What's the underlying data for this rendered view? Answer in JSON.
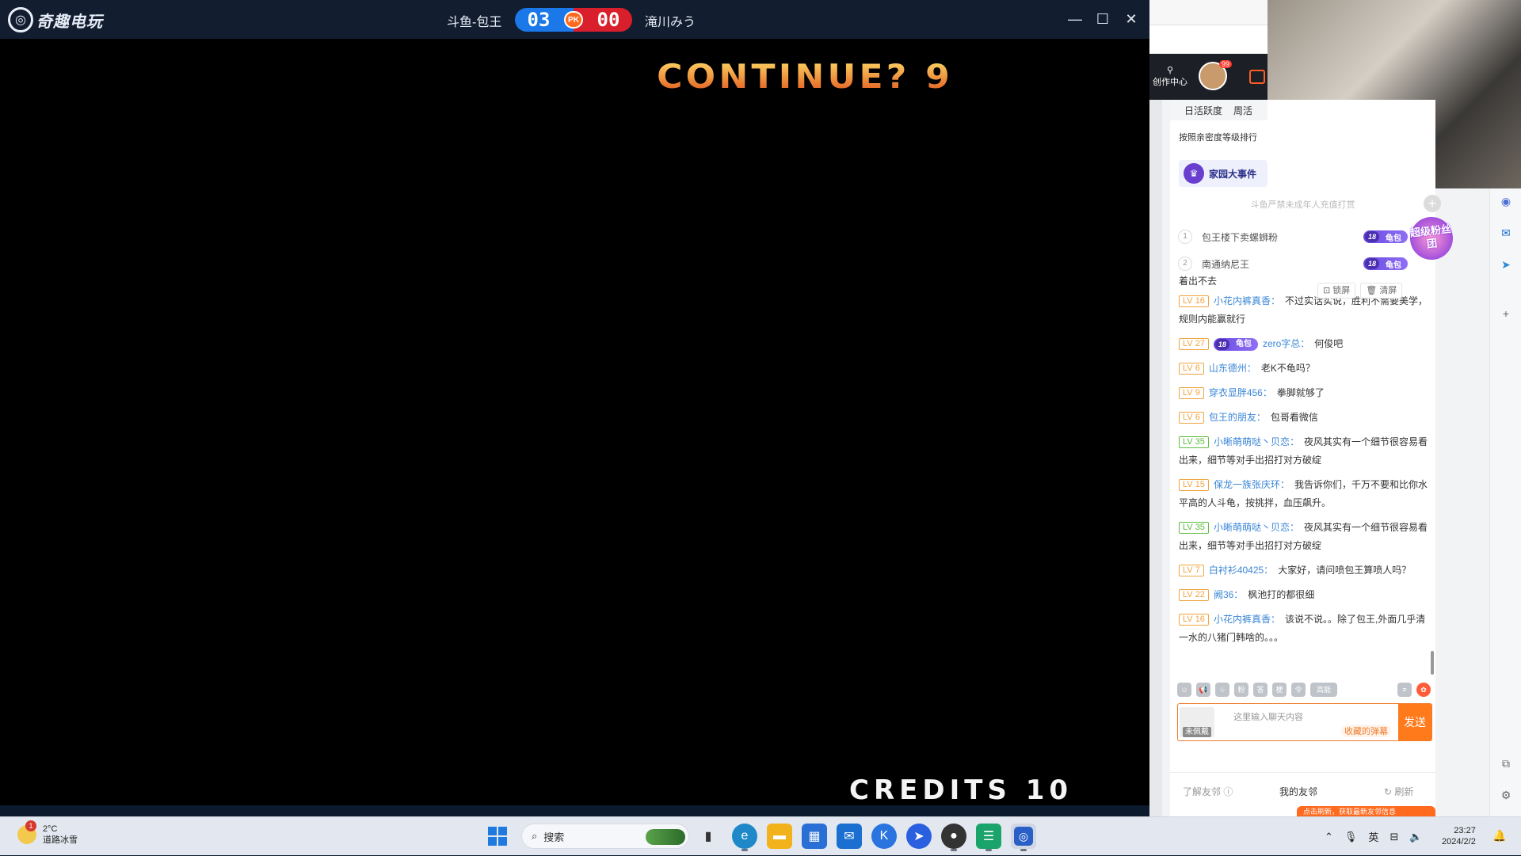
{
  "titlebar": {
    "app_name": "奇趣电玩",
    "player1": "斗鱼-包王",
    "score1": "03",
    "pk_label": "PK",
    "score2": "00",
    "player2": "滝川みう"
  },
  "game": {
    "continue_text": "CONTINUE? 9",
    "credits_text": "CREDITS 10"
  },
  "nav": {
    "creator_center": "创作中心",
    "avatar_badge": "99"
  },
  "chat": {
    "tabs": [
      "日活跃度",
      "周活"
    ],
    "rank_hint": "按照亲密度等级排行",
    "family_label": "家园大事件",
    "notice": "斗鱼严禁未成年人充值打赏",
    "superfan": "超级粉丝团",
    "ranking": [
      {
        "rank": "1",
        "name": "包王楼下卖螺蛳粉",
        "fan_level": "18",
        "fan_club": "龟包"
      },
      {
        "rank": "2",
        "name": "南通纳尼王",
        "fan_level": "18",
        "fan_club": "龟包"
      }
    ],
    "lock_label": "锁屏",
    "clear_label": "清屏",
    "partial_top": "着出不去",
    "messages": [
      {
        "lv": "LV 16",
        "user": "小花内裤真香：",
        "text": "不过实话实说，胜利不需要美学，规则内能赢就行"
      },
      {
        "lv": "LV 27",
        "fan_level": "18",
        "fan_club": "龟包",
        "user": "zero字总：",
        "text": "何俊吧"
      },
      {
        "lv": "LV 6",
        "user": "山东德州：",
        "text": "老K不龟吗？"
      },
      {
        "lv": "LV 9",
        "user": "穿衣显胖456：",
        "text": "拳脚就够了"
      },
      {
        "lv": "LV 6",
        "user": "包王的朋友：",
        "text": "包哥看微信"
      },
      {
        "lv": "LV 35",
        "user": "小晰萌萌哒丶贝恋：",
        "text": "夜风其实有一个细节很容易看出来，细节等对手出招打对方破绽"
      },
      {
        "lv": "LV 15",
        "user": "保龙一族张庆环：",
        "text": "我告诉你们，千万不要和比你水平高的人斗龟，按挑拌，血压飙升。"
      },
      {
        "lv": "LV 35",
        "user": "小晰萌萌哒丶贝恋：",
        "text": "夜风其实有一个细节很容易看出来，细节等对手出招打对方破绽"
      },
      {
        "lv": "LV 7",
        "user": "白衬衫40425：",
        "text": "大家好，请问喷包王算喷人吗？"
      },
      {
        "lv": "LV 22",
        "user": "阙36：",
        "text": "枫池打的都很细"
      },
      {
        "lv": "LV 16",
        "user": "小花内裤真香：",
        "text": "该说不说。。除了包王,外面几乎清一水的八猪门韩啥的。。。"
      }
    ],
    "icon_labels": [
      "粉",
      "答",
      "梗",
      "令",
      "高能"
    ],
    "not_worn": "未佩戴",
    "input_placeholder": "这里输入聊天内容",
    "favorite_danmu": "收藏的弹幕",
    "send": "发送"
  },
  "friends": {
    "know_friends": "了解友邻",
    "my_neighbors": "我的友邻",
    "refresh": "刷新",
    "banner": "点击刷新，获取最新友邻信息"
  },
  "taskbar": {
    "weather_badge": "1",
    "temperature": "2°C",
    "weather_desc": "道路冰雪",
    "search_label": "搜索",
    "ime": "英",
    "time": "23:27",
    "date": "2024/2/2"
  },
  "colors": {
    "accent_orange": "#ff7a1a",
    "score_blue": "#1a78e8",
    "score_red": "#d91f2b",
    "level_orange": "#f0a540",
    "user_blue": "#3a86d6"
  }
}
